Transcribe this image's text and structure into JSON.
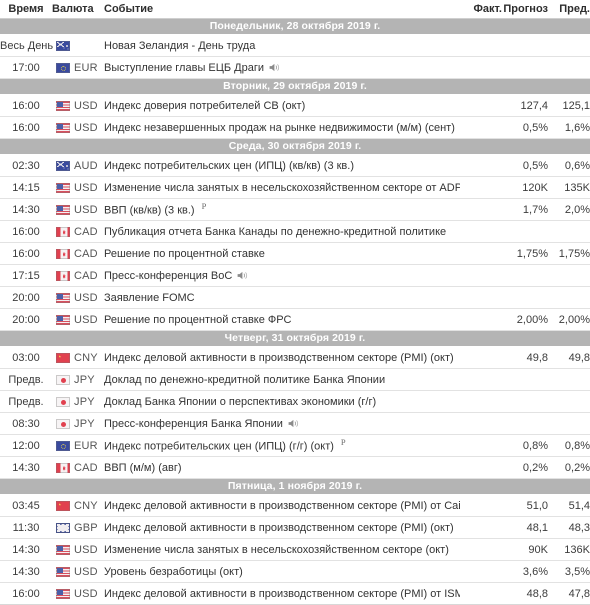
{
  "header": {
    "time": "Время",
    "currency": "Валюта",
    "event": "Событие",
    "actual": "Факт.",
    "forecast": "Прогноз",
    "previous": "Пред."
  },
  "colors": {
    "date_band_bg": "#b4b4b4",
    "date_band_text": "#ffffff",
    "row_border": "#e2e2e2",
    "body_text": "#333333",
    "page_bg": "#ffffff"
  },
  "sections": [
    {
      "date": "Понедельник, 28 октября 2019 г.",
      "rows": [
        {
          "time": "Весь День",
          "flag": "nzd",
          "currency": "",
          "event": "Новая Зеландия - День труда",
          "speaker": false,
          "preliminary": false,
          "actual": "",
          "forecast": "",
          "previous": ""
        },
        {
          "time": "17:00",
          "flag": "eur",
          "currency": "EUR",
          "event": "Выступление главы ЕЦБ Драги",
          "speaker": true,
          "preliminary": false,
          "actual": "",
          "forecast": "",
          "previous": ""
        }
      ]
    },
    {
      "date": "Вторник, 29 октября 2019 г.",
      "rows": [
        {
          "time": "16:00",
          "flag": "usd",
          "currency": "USD",
          "event": "Индекс доверия потребителей СВ (окт)",
          "speaker": false,
          "preliminary": false,
          "actual": "",
          "forecast": "127,4",
          "previous": "125,1"
        },
        {
          "time": "16:00",
          "flag": "usd",
          "currency": "USD",
          "event": "Индекс незавершенных продаж на рынке недвижимости (м/м) (сент)",
          "speaker": false,
          "preliminary": false,
          "actual": "",
          "forecast": "0,5%",
          "previous": "1,6%"
        }
      ]
    },
    {
      "date": "Среда, 30 октября 2019 г.",
      "rows": [
        {
          "time": "02:30",
          "flag": "aud",
          "currency": "AUD",
          "event": "Индекс потребительских цен (ИПЦ) (кв/кв) (3 кв.)",
          "speaker": false,
          "preliminary": false,
          "actual": "",
          "forecast": "0,5%",
          "previous": "0,6%"
        },
        {
          "time": "14:15",
          "flag": "usd",
          "currency": "USD",
          "event": "Изменение числа занятых в несельскохозяйственном секторе от ADP (окт)",
          "speaker": false,
          "preliminary": false,
          "actual": "",
          "forecast": "120K",
          "previous": "135K"
        },
        {
          "time": "14:30",
          "flag": "usd",
          "currency": "USD",
          "event": "ВВП (кв/кв) (3 кв.)",
          "speaker": false,
          "preliminary": true,
          "actual": "",
          "forecast": "1,7%",
          "previous": "2,0%"
        },
        {
          "time": "16:00",
          "flag": "cad",
          "currency": "CAD",
          "event": "Публикация отчета Банка Канады по денежно-кредитной политике",
          "speaker": false,
          "preliminary": false,
          "actual": "",
          "forecast": "",
          "previous": ""
        },
        {
          "time": "16:00",
          "flag": "cad",
          "currency": "CAD",
          "event": "Решение по процентной ставке",
          "speaker": false,
          "preliminary": false,
          "actual": "",
          "forecast": "1,75%",
          "previous": "1,75%"
        },
        {
          "time": "17:15",
          "flag": "cad",
          "currency": "CAD",
          "event": "Пресс-конференция BoC",
          "speaker": true,
          "preliminary": false,
          "actual": "",
          "forecast": "",
          "previous": ""
        },
        {
          "time": "20:00",
          "flag": "usd",
          "currency": "USD",
          "event": "Заявление FOMC",
          "speaker": false,
          "preliminary": false,
          "actual": "",
          "forecast": "",
          "previous": ""
        },
        {
          "time": "20:00",
          "flag": "usd",
          "currency": "USD",
          "event": "Решение по процентной ставке ФРС",
          "speaker": false,
          "preliminary": false,
          "actual": "",
          "forecast": "2,00%",
          "previous": "2,00%"
        }
      ]
    },
    {
      "date": "Четверг, 31 октября 2019 г.",
      "rows": [
        {
          "time": "03:00",
          "flag": "cny",
          "currency": "CNY",
          "event": "Индекс деловой активности в производственном секторе (PMI) (окт)",
          "speaker": false,
          "preliminary": false,
          "actual": "",
          "forecast": "49,8",
          "previous": "49,8"
        },
        {
          "time": "Предв.",
          "flag": "jpy",
          "currency": "JPY",
          "event": "Доклад по денежно-кредитной политике Банка Японии",
          "speaker": false,
          "preliminary": false,
          "actual": "",
          "forecast": "",
          "previous": ""
        },
        {
          "time": "Предв.",
          "flag": "jpy",
          "currency": "JPY",
          "event": "Доклад Банка Японии о перспективах экономики (г/г)",
          "speaker": false,
          "preliminary": false,
          "actual": "",
          "forecast": "",
          "previous": ""
        },
        {
          "time": "08:30",
          "flag": "jpy",
          "currency": "JPY",
          "event": "Пресс-конференция Банка Японии",
          "speaker": true,
          "preliminary": false,
          "actual": "",
          "forecast": "",
          "previous": ""
        },
        {
          "time": "12:00",
          "flag": "eur",
          "currency": "EUR",
          "event": "Индекс потребительских цен (ИПЦ) (г/г) (окт)",
          "speaker": false,
          "preliminary": true,
          "actual": "",
          "forecast": "0,8%",
          "previous": "0,8%"
        },
        {
          "time": "14:30",
          "flag": "cad",
          "currency": "CAD",
          "event": "ВВП (м/м) (авг)",
          "speaker": false,
          "preliminary": false,
          "actual": "",
          "forecast": "0,2%",
          "previous": "0,2%"
        }
      ]
    },
    {
      "date": "Пятница, 1 ноября 2019 г.",
      "rows": [
        {
          "time": "03:45",
          "flag": "cny",
          "currency": "CNY",
          "event": "Индекс деловой активности в производственном секторе (PMI) от Caixin (окт)",
          "speaker": false,
          "preliminary": false,
          "actual": "",
          "forecast": "51,0",
          "previous": "51,4"
        },
        {
          "time": "11:30",
          "flag": "gbp",
          "currency": "GBP",
          "event": "Индекс деловой активности в производственном секторе (PMI) (окт)",
          "speaker": false,
          "preliminary": false,
          "actual": "",
          "forecast": "48,1",
          "previous": "48,3"
        },
        {
          "time": "14:30",
          "flag": "usd",
          "currency": "USD",
          "event": "Изменение числа занятых в несельскохозяйственном секторе (окт)",
          "speaker": false,
          "preliminary": false,
          "actual": "",
          "forecast": "90K",
          "previous": "136K"
        },
        {
          "time": "14:30",
          "flag": "usd",
          "currency": "USD",
          "event": "Уровень безработицы (окт)",
          "speaker": false,
          "preliminary": false,
          "actual": "",
          "forecast": "3,6%",
          "previous": "3,5%"
        },
        {
          "time": "16:00",
          "flag": "usd",
          "currency": "USD",
          "event": "Индекс деловой активности в производственном секторе (PMI) от ISM (окт)",
          "speaker": false,
          "preliminary": false,
          "actual": "",
          "forecast": "48,8",
          "previous": "47,8"
        }
      ]
    }
  ]
}
